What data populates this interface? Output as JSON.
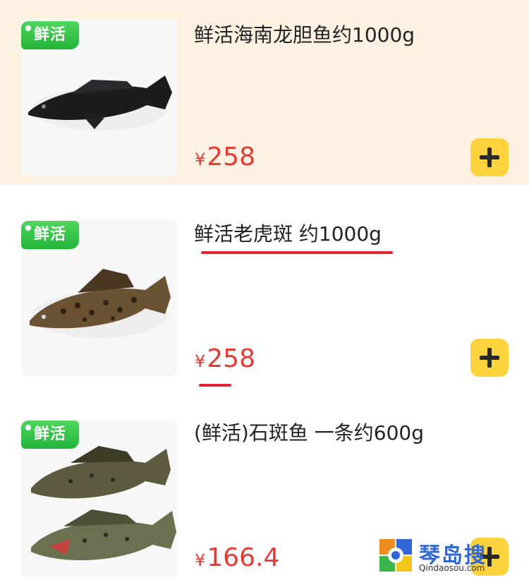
{
  "products": [
    {
      "badge": "鲜活",
      "title": "鲜活海南龙胆鱼约1000g",
      "currency": "¥",
      "price": "258"
    },
    {
      "badge": "鲜活",
      "title": "鲜活老虎斑 约1000g",
      "currency": "¥",
      "price": "258"
    },
    {
      "badge": "鲜活",
      "title": "(鲜活)石斑鱼 一条约600g",
      "currency": "¥",
      "price": "166.4"
    }
  ],
  "watermark": {
    "name": "琴岛搜",
    "url": "Qindaosou.com"
  },
  "colors": {
    "accent_price": "#e83a34",
    "badge_green": "#22b43a",
    "add_button": "#fdd23c",
    "highlight_bg": "#fdf2e2"
  }
}
